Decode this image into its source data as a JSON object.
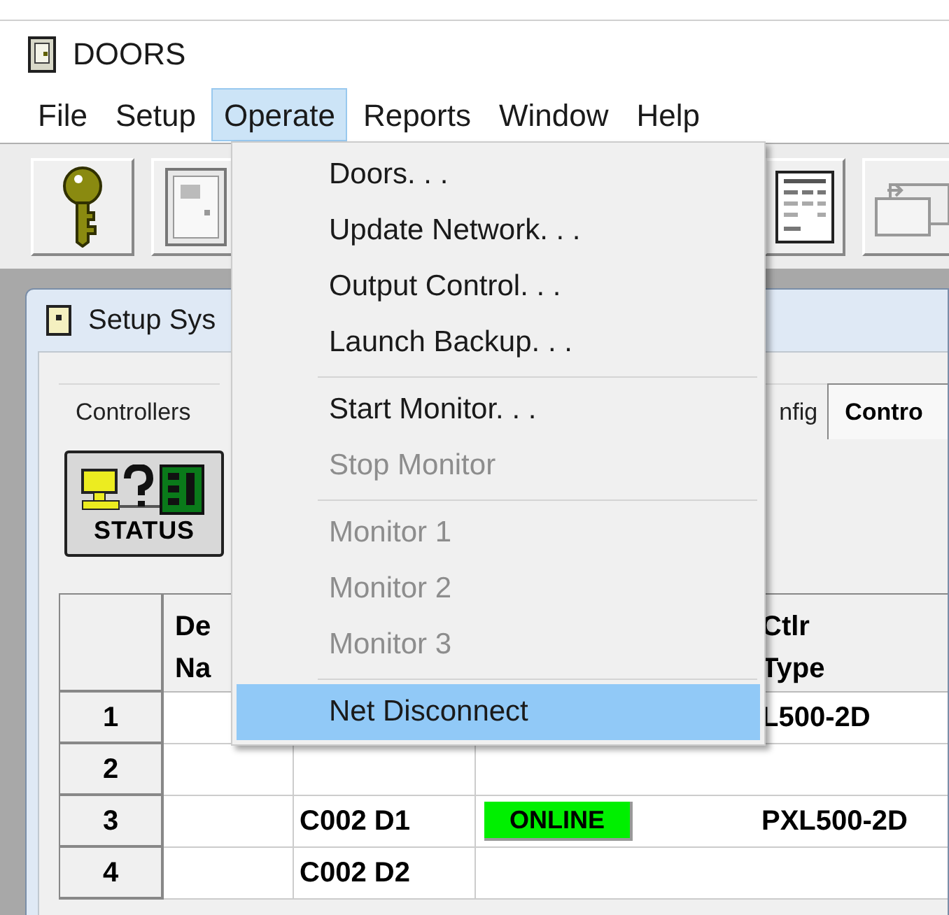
{
  "window": {
    "title": "DOORS"
  },
  "menu_bar": [
    {
      "label": "File",
      "selected": false
    },
    {
      "label": "Setup",
      "selected": false
    },
    {
      "label": "Operate",
      "selected": true
    },
    {
      "label": "Reports",
      "selected": false
    },
    {
      "label": "Window",
      "selected": false
    },
    {
      "label": "Help",
      "selected": false
    }
  ],
  "operate_menu": [
    {
      "label": "Doors. . .",
      "disabled": false,
      "selected": false,
      "separator_before": false
    },
    {
      "label": "Update Network. . .",
      "disabled": false,
      "selected": false,
      "separator_before": false
    },
    {
      "label": "Output Control. . .",
      "disabled": false,
      "selected": false,
      "separator_before": false
    },
    {
      "label": "Launch Backup. . .",
      "disabled": false,
      "selected": false,
      "separator_before": false
    },
    {
      "label": "Start Monitor. . .",
      "disabled": false,
      "selected": false,
      "separator_before": true
    },
    {
      "label": "Stop Monitor",
      "disabled": true,
      "selected": false,
      "separator_before": false
    },
    {
      "label": "Monitor 1",
      "disabled": true,
      "selected": false,
      "separator_before": true
    },
    {
      "label": "Monitor 2",
      "disabled": true,
      "selected": false,
      "separator_before": false
    },
    {
      "label": "Monitor 3",
      "disabled": true,
      "selected": false,
      "separator_before": false
    },
    {
      "label": "Net Disconnect",
      "disabled": false,
      "selected": true,
      "separator_before": true
    }
  ],
  "child_window": {
    "title": "Setup Sys",
    "tabs": [
      {
        "label": "Controllers",
        "selected": false
      },
      {
        "label": "nfig",
        "selected": false
      },
      {
        "label": "Contro",
        "selected": true
      }
    ],
    "status_button": {
      "label": "STATUS"
    },
    "grid": {
      "columns": [
        {
          "lines": [
            "De",
            "Na"
          ]
        },
        {
          "lines": [
            "Ctlr",
            "Type"
          ]
        }
      ],
      "rows": [
        {
          "number": "1",
          "door": "",
          "status": "",
          "ctlr_type": "L500-2D"
        },
        {
          "number": "2",
          "door": "",
          "status": "",
          "ctlr_type": ""
        },
        {
          "number": "3",
          "door": "C002 D1",
          "status": "ONLINE",
          "ctlr_type": "PXL500-2D"
        },
        {
          "number": "4",
          "door": "C002 D2",
          "status": "",
          "ctlr_type": ""
        }
      ]
    }
  }
}
